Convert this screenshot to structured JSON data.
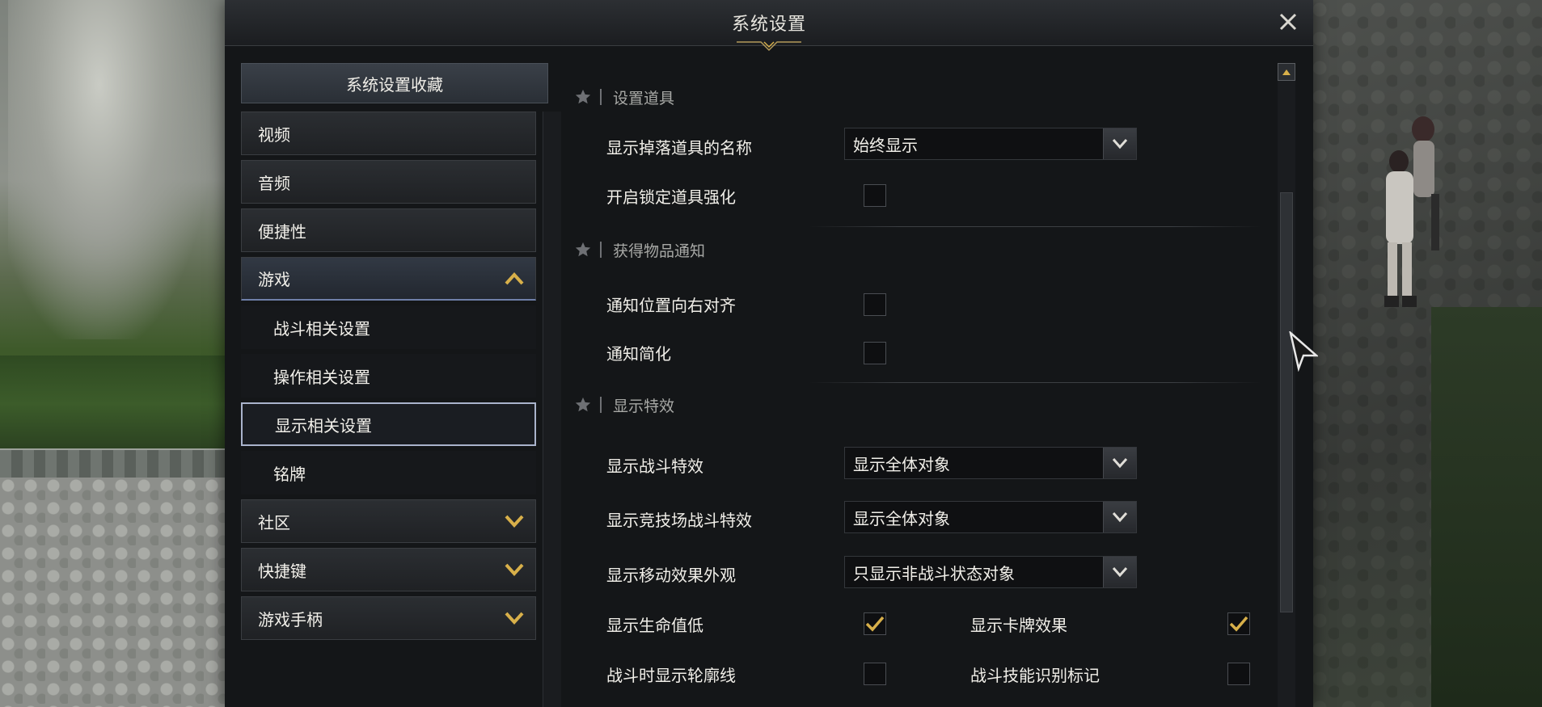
{
  "window": {
    "title": "系统设置",
    "close_label": "X"
  },
  "nav": {
    "favorites_label": "系统设置收藏",
    "items": [
      {
        "label": "视频",
        "type": "category",
        "arrow": "none"
      },
      {
        "label": "音频",
        "type": "category",
        "arrow": "none"
      },
      {
        "label": "便捷性",
        "type": "category",
        "arrow": "none"
      },
      {
        "label": "游戏",
        "type": "category",
        "arrow": "up",
        "active": true
      },
      {
        "label": "战斗相关设置",
        "type": "sub"
      },
      {
        "label": "操作相关设置",
        "type": "sub"
      },
      {
        "label": "显示相关设置",
        "type": "sub",
        "selected": true
      },
      {
        "label": "铭牌",
        "type": "sub"
      },
      {
        "label": "社区",
        "type": "category",
        "arrow": "down"
      },
      {
        "label": "快捷键",
        "type": "category",
        "arrow": "down"
      },
      {
        "label": "游戏手柄",
        "type": "category",
        "arrow": "down"
      }
    ]
  },
  "sections": {
    "items_settings": {
      "title": "设置道具",
      "show_drop_names": {
        "label": "显示掉落道具的名称",
        "value": "始终显示"
      },
      "lock_enhance": {
        "label": "开启锁定道具强化",
        "checked": false
      }
    },
    "item_notify": {
      "title": "获得物品通知",
      "align_right": {
        "label": "通知位置向右对齐",
        "checked": false
      },
      "simplify": {
        "label": "通知简化",
        "checked": false
      }
    },
    "effects": {
      "title": "显示特效",
      "combat_fx": {
        "label": "显示战斗特效",
        "value": "显示全体对象"
      },
      "arena_fx": {
        "label": "显示竞技场战斗特效",
        "value": "显示全体对象"
      },
      "move_fx": {
        "label": "显示移动效果外观",
        "value": "只显示非战斗状态对象"
      },
      "low_hp": {
        "label": "显示生命值低",
        "checked": true
      },
      "card_fx": {
        "label": "显示卡牌效果",
        "checked": true
      },
      "outline": {
        "label": "战斗时显示轮廓线",
        "checked": false
      },
      "skill_mark": {
        "label": "战斗技能识别标记",
        "checked": false
      }
    }
  },
  "colors": {
    "accent_gold": "#d8b04a",
    "text": "#f1efe9",
    "muted": "#a8a9a6",
    "panel": "#141618"
  }
}
